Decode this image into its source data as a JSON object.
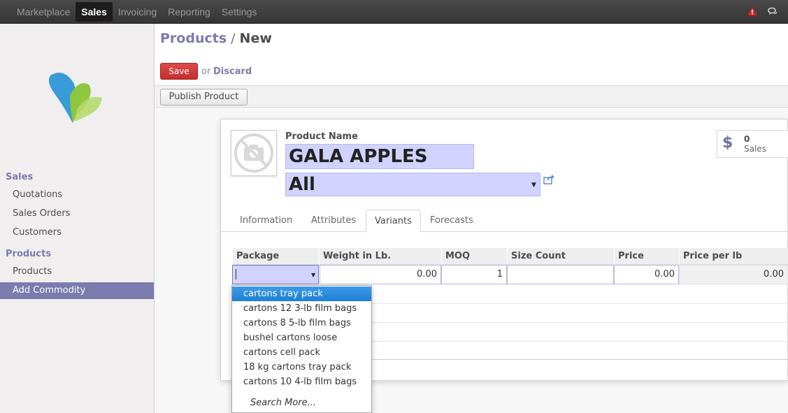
{
  "topbar": {
    "menu": [
      "Marketplace",
      "Sales",
      "Invoicing",
      "Reporting",
      "Settings"
    ],
    "active": "Sales",
    "alert_color": "#e02424"
  },
  "sidebar": {
    "sections": [
      {
        "title": "Sales",
        "items": [
          "Quotations",
          "Sales Orders",
          "Customers"
        ]
      },
      {
        "title": "Products",
        "items": [
          "Products",
          "Add Commodity"
        ]
      }
    ],
    "active_item": "Add Commodity",
    "accent_color": "#7c7bad"
  },
  "breadcrumb": {
    "parent": "Products",
    "separator": "/",
    "current": "New"
  },
  "actions": {
    "save": "Save",
    "or": "or",
    "discard": "Discard",
    "publish": "Publish Product"
  },
  "form": {
    "name_label": "Product Name",
    "name_value": "GALA APPLES",
    "category_value": "All",
    "sales_count": "0",
    "sales_label": "Sales",
    "sales_icon": "dollar-icon"
  },
  "tabs": [
    "Information",
    "Attributes",
    "Variants",
    "Forecasts"
  ],
  "active_tab": "Variants",
  "variants_table": {
    "columns": [
      "Package",
      "Weight in Lb.",
      "MOQ",
      "Size Count",
      "Price",
      "Price per lb"
    ],
    "row": {
      "package": "",
      "weight": "0.00",
      "moq": "1",
      "size_count": "",
      "price": "0.00",
      "price_per_lb": "0.00"
    }
  },
  "package_dropdown": {
    "options": [
      "cartons tray pack",
      "cartons 12 3-lb film bags",
      "cartons 8 5-lb film bags",
      "bushel cartons loose",
      "cartons cell pack",
      "18 kg cartons tray pack",
      "cartons 10 4-lb film bags"
    ],
    "highlighted": "cartons tray pack",
    "search_more": "Search More..."
  }
}
